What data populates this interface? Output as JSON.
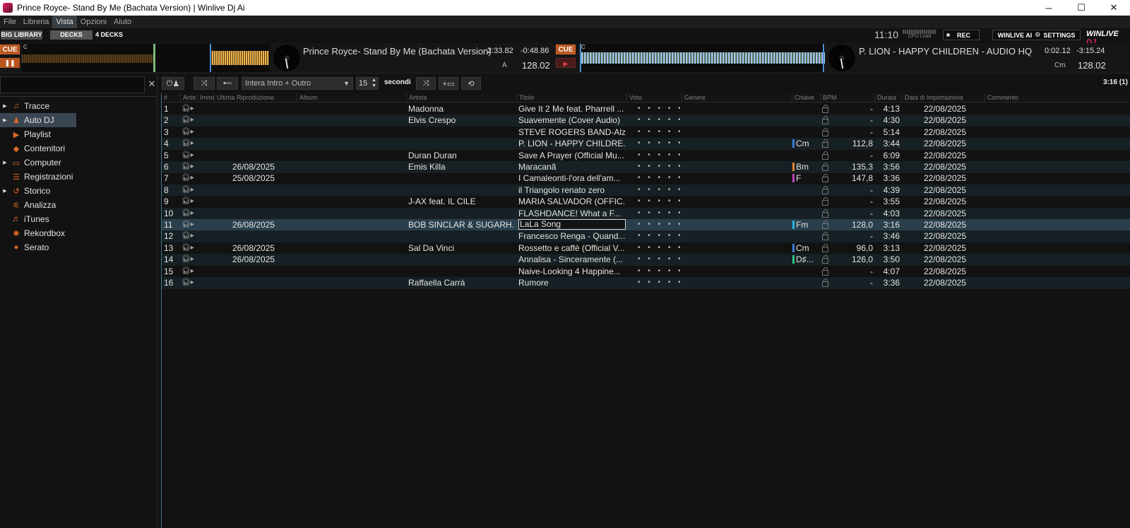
{
  "window": {
    "title": "Prince Royce- Stand By Me (Bachata Version) | Winlive Dj Ai",
    "minimize": "─",
    "maximize": "☐",
    "close": "✕"
  },
  "menu": [
    "File",
    "Libreria",
    "Vista",
    "Opzioni",
    "Aiuto"
  ],
  "top": {
    "big_library": "BIG LIBRARY",
    "decks": "DECKS",
    "four_decks": "4 DECKS",
    "clock": "11:10",
    "cpu_label": "CPU Load",
    "rec": "REC",
    "settings": "WINLIVE AI",
    "settings2": "SETTINGS",
    "logo_a": "WINLIVE",
    "logo_b": "DJ"
  },
  "deckA": {
    "cue": "CUE",
    "play": "❚❚",
    "key_marker": "C",
    "title": "Prince Royce- Stand By Me (Bachata Version)",
    "elapsed": "2:33.82",
    "remaining": "-0:48.86",
    "deck_letter": "A",
    "bpm": "128.02",
    "colors": {
      "wave_played": "#6a4a1e",
      "wave_hot": "#f0a030"
    }
  },
  "deckB": {
    "cue": "CUE",
    "play": "▶",
    "key_marker": "C",
    "title": "P. LION - HAPPY CHILDREN - AUDIO HQ",
    "elapsed": "0:02.12",
    "remaining": "-3:15.24",
    "key": "Cm",
    "bpm": "128.02",
    "colors": {
      "wave": "#9fd8f0"
    }
  },
  "sidebar": {
    "items": [
      {
        "label": "Tracce",
        "icon": "music-icon",
        "glyph": "♫",
        "arrow": true,
        "active": false
      },
      {
        "label": "Auto DJ",
        "icon": "robot-icon",
        "glyph": "♟",
        "arrow": true,
        "active": true
      },
      {
        "label": "Playlist",
        "icon": "playlist-icon",
        "glyph": "▶",
        "arrow": false,
        "active": false
      },
      {
        "label": "Contenitori",
        "icon": "crate-icon",
        "glyph": "◆",
        "arrow": false,
        "active": false
      },
      {
        "label": "Computer",
        "icon": "computer-icon",
        "glyph": "▭",
        "arrow": true,
        "active": false
      },
      {
        "label": "Registrazioni",
        "icon": "recordings-icon",
        "glyph": "☰",
        "arrow": false,
        "active": false
      },
      {
        "label": "Storico",
        "icon": "history-icon",
        "glyph": "↺",
        "arrow": true,
        "active": false
      },
      {
        "label": "Analizza",
        "icon": "analyze-icon",
        "glyph": "⚟",
        "arrow": false,
        "active": false
      },
      {
        "label": "iTunes",
        "icon": "itunes-icon",
        "glyph": "♬",
        "arrow": false,
        "active": false
      },
      {
        "label": "Rekordbox",
        "icon": "rekordbox-icon",
        "glyph": "✺",
        "arrow": false,
        "active": false
      },
      {
        "label": "Serato",
        "icon": "serato-icon",
        "glyph": "●",
        "arrow": false,
        "active": false
      }
    ]
  },
  "toolbar": {
    "transition": "Intera Intro + Outro",
    "seconds_value": "15",
    "seconds_label": "secondi",
    "total": "3:16 (1)"
  },
  "table": {
    "columns": [
      "#",
      "Ante",
      "Imma",
      "Ultima Riproduzione",
      "Album",
      "Artista",
      "Titolo",
      "Voto",
      "Genere",
      "Chiave",
      "BPM",
      "Durata",
      "Data di Importazione",
      "Commento"
    ],
    "rows": [
      {
        "n": "1",
        "last": "",
        "artist": "Madonna",
        "title": "Give It 2 Me feat. Pharrell ...",
        "rating": "• • • • •",
        "key": "",
        "key_color": "",
        "bpm": "-",
        "dur": "4:13",
        "imp": "22/08/2025"
      },
      {
        "n": "2",
        "last": "",
        "artist": "Elvis Crespo",
        "title": "Suavemente (Cover Audio)",
        "rating": "• • • • •",
        "key": "",
        "key_color": "",
        "bpm": "-",
        "dur": "4:30",
        "imp": "22/08/2025"
      },
      {
        "n": "3",
        "last": "",
        "artist": "",
        "title": "STEVE ROGERS BAND-Alz...",
        "rating": "• • • • •",
        "key": "",
        "key_color": "",
        "bpm": "-",
        "dur": "5:14",
        "imp": "22/08/2025"
      },
      {
        "n": "4",
        "last": "",
        "artist": "",
        "title": "P. LION - HAPPY CHILDRE...",
        "rating": "• • • • •",
        "key": "Cm",
        "key_color": "#3a7ad8",
        "bpm": "112,8",
        "dur": "3:44",
        "imp": "22/08/2025"
      },
      {
        "n": "5",
        "last": "",
        "artist": "Duran Duran",
        "title": "Save A Prayer (Official Mu...",
        "rating": "• • • • •",
        "key": "",
        "key_color": "",
        "bpm": "-",
        "dur": "6:09",
        "imp": "22/08/2025"
      },
      {
        "n": "6",
        "last": "26/08/2025",
        "artist": "Emis Killa",
        "title": "Maracanã",
        "rating": "• • • • •",
        "key": "Bm",
        "key_color": "#e0862a",
        "bpm": "135,3",
        "dur": "3:56",
        "imp": "22/08/2025"
      },
      {
        "n": "7",
        "last": "25/08/2025",
        "artist": "",
        "title": "I Camaleonti-l'ora dell'am...",
        "rating": "• • • • •",
        "key": "F",
        "key_color": "#c040c0",
        "bpm": "147,8",
        "dur": "3:36",
        "imp": "22/08/2025"
      },
      {
        "n": "8",
        "last": "",
        "artist": "",
        "title": "il Triangolo renato zero",
        "rating": "• • • • •",
        "key": "",
        "key_color": "",
        "bpm": "-",
        "dur": "4:39",
        "imp": "22/08/2025"
      },
      {
        "n": "9",
        "last": "",
        "artist": "J-AX feat. IL CILE",
        "title": "MARIA SALVADOR (OFFIC...",
        "rating": "• • • • •",
        "key": "",
        "key_color": "",
        "bpm": "-",
        "dur": "3:55",
        "imp": "22/08/2025"
      },
      {
        "n": "10",
        "last": "",
        "artist": "",
        "title": "FLASHDANCE!   What a F...",
        "rating": "• • • • •",
        "key": "",
        "key_color": "",
        "bpm": "-",
        "dur": "4:03",
        "imp": "22/08/2025"
      },
      {
        "n": "11",
        "last": "26/08/2025",
        "artist": "BOB SINCLAR & SUGARH...",
        "title": "LaLa Song",
        "rating": "• • • • •",
        "key": "Fm",
        "key_color": "#20b8d8",
        "bpm": "128,0",
        "dur": "3:16",
        "imp": "22/08/2025",
        "selected": true
      },
      {
        "n": "12",
        "last": "",
        "artist": "",
        "title": "Francesco Renga - Quand...",
        "rating": "• • • • •",
        "key": "",
        "key_color": "",
        "bpm": "-",
        "dur": "3:46",
        "imp": "22/08/2025"
      },
      {
        "n": "13",
        "last": "26/08/2025",
        "artist": "Sal Da Vinci",
        "title": "Rossetto e caffè (Official V...",
        "rating": "• • • • •",
        "key": "Cm",
        "key_color": "#3a7ad8",
        "bpm": "96,0",
        "dur": "3:13",
        "imp": "22/08/2025"
      },
      {
        "n": "14",
        "last": "26/08/2025",
        "artist": "",
        "title": "Annalisa - Sinceramente (...",
        "rating": "• • • • •",
        "key": "D♯...",
        "key_color": "#30c080",
        "bpm": "126,0",
        "dur": "3:50",
        "imp": "22/08/2025"
      },
      {
        "n": "15",
        "last": "",
        "artist": "",
        "title": "Naive-Looking 4 Happine...",
        "rating": "• • • • •",
        "key": "",
        "key_color": "",
        "bpm": "-",
        "dur": "4:07",
        "imp": "22/08/2025"
      },
      {
        "n": "16",
        "last": "",
        "artist": "Raffaella Carrà",
        "title": "Rumore",
        "rating": "• • • • •",
        "key": "",
        "key_color": "",
        "bpm": "-",
        "dur": "3:36",
        "imp": "22/08/2025"
      }
    ]
  }
}
